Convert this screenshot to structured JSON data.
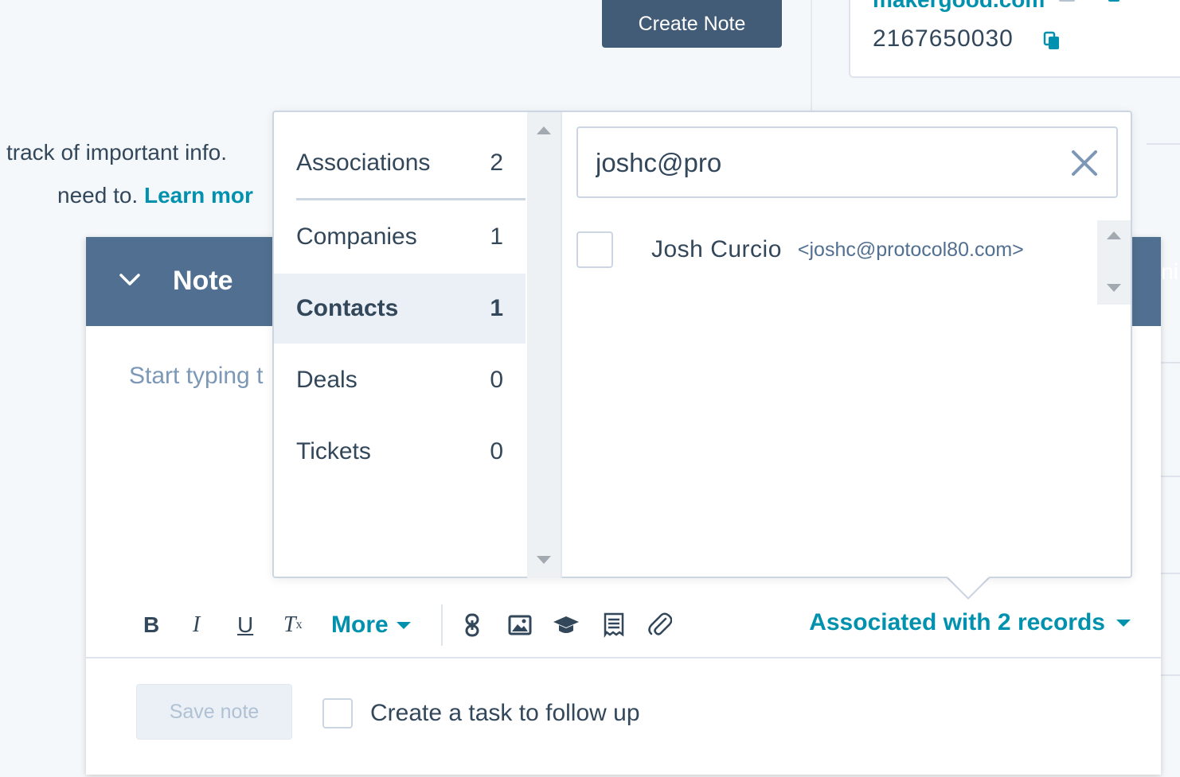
{
  "background": {
    "create_note_button": "Create Note",
    "info_card": {
      "email": "makergood.com",
      "phone": "2167650030"
    },
    "track_text": "track of important info.",
    "need_text": "need to.",
    "learn_more": "Learn mor"
  },
  "note": {
    "title": "Note",
    "header_extra": "ni",
    "placeholder": "Start typing t",
    "toolbar": {
      "bold": "B",
      "italic": "I",
      "underline": "U",
      "clear_format": "T",
      "clear_format_sub": "x",
      "more": "More",
      "icons": [
        "link-icon",
        "image-icon",
        "graduation-cap-icon",
        "document-icon",
        "paperclip-icon"
      ],
      "associated": "Associated with 2 records"
    },
    "save_button": "Save note",
    "followup_label": "Create a task to follow up"
  },
  "associations": {
    "categories": [
      {
        "label": "Associations",
        "count": "2"
      },
      {
        "label": "Companies",
        "count": "1"
      },
      {
        "label": "Contacts",
        "count": "1"
      },
      {
        "label": "Deals",
        "count": "0"
      },
      {
        "label": "Tickets",
        "count": "0"
      }
    ],
    "active_category": "Contacts",
    "search_value": "joshc@pro",
    "results": [
      {
        "name": "Josh Curcio",
        "email": "<joshc@protocol80.com>"
      }
    ]
  },
  "colors": {
    "header": "#516f90",
    "accent": "#0091ae",
    "button_dark": "#425b76",
    "text": "#33475b"
  }
}
